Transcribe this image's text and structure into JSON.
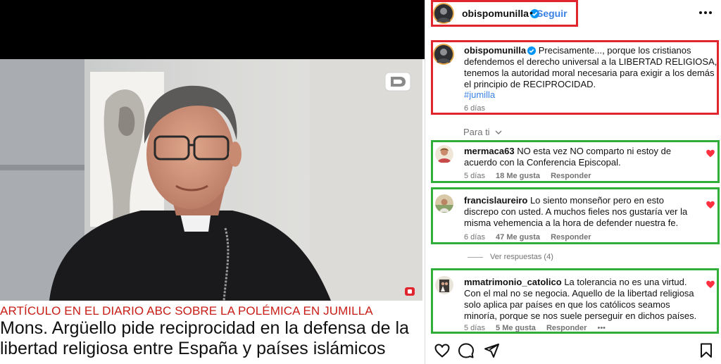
{
  "media": {
    "kicker": "ARTÍCULO EN EL DIARIO ABC SOBRE LA POLÉMICA EN JUMILLA",
    "headline": "Mons. Argüello pide reciprocidad en la defensa de la\nlibertad religiosa entre España y países islámicos",
    "logo_icon": "d-logo-icon"
  },
  "post": {
    "header": {
      "username": "obispomunilla",
      "dot": "•",
      "follow_label": "Seguir"
    },
    "caption": {
      "username": "obispomunilla",
      "text": "Precisamente..., porque los cristianos defendemos el derecho universal a la LIBERTAD RELIGIOSA, tenemos la autoridad moral necesaria para exigir a los demás el principio de RECIPROCIDAD.",
      "hashtag": "#jumilla",
      "time": "6 días"
    },
    "sort_label": "Para ti",
    "comments": [
      {
        "username": "mermaca63",
        "text": "NO esta vez NO comparto ni estoy de acuerdo con la Conferencia Episcopal.",
        "time": "5 días",
        "likes": "18 Me gusta",
        "reply_label": "Responder"
      },
      {
        "username": "francislaureiro",
        "text": "Lo siento monseñor pero en esto discrepo con usted. A muchos fieles nos gustaría ver la misma vehemencia a la hora de defender nuestra fe.",
        "time": "6 días",
        "likes": "47 Me gusta",
        "reply_label": "Responder"
      },
      {
        "username": "mmatrimonio_catolico",
        "text": "La tolerancia no es una virtud. Con el mal no se negocia. Aquello de la libertad religiosa solo aplica par países en que los católicos seamos minoría, porque se nos suele perseguir en dichos países.",
        "time": "5 días",
        "likes": "5 Me gusta",
        "reply_label": "Responder",
        "more": "•••"
      }
    ],
    "view_replies_label": "Ver respuestas (4)",
    "colors": {
      "accent": "#3b82e6",
      "like_red": "#ff3040",
      "highlight_red": "#e0252f",
      "highlight_green": "#2fae3a"
    }
  }
}
